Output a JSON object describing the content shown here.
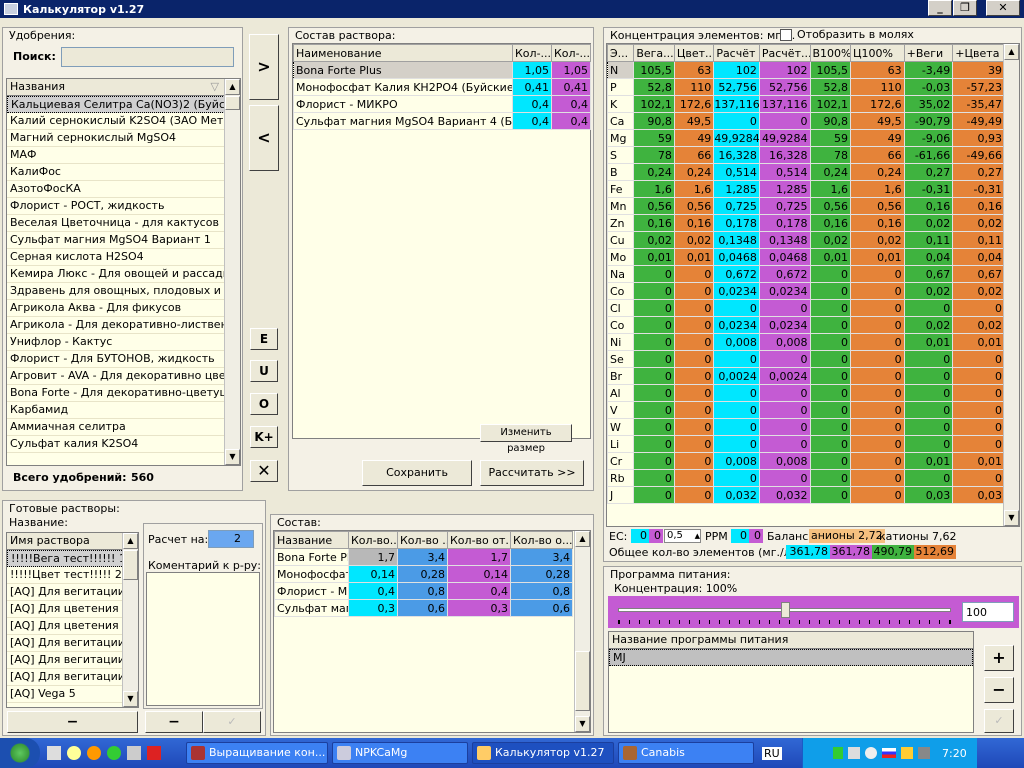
{
  "window": {
    "title": "Калькулятор v1.27",
    "btn_min": "_",
    "btn_max": "❐",
    "btn_close": "✕"
  },
  "fert": {
    "title": "Удобрения:",
    "search_label": "Поиск:",
    "search_value": "",
    "col_header": "Названия",
    "total_label": "Всего удобрений:",
    "total_value": "560",
    "items": [
      "Кальциевая Селитра Ca(NO3)2 (Буйские у",
      "Калий  сернокислый  K2SO4 (ЗАО Метахи",
      "Магний сернокислый MgSO4",
      "МАФ",
      "КалиФос",
      "АзотоФосКА",
      "Флорист - РОСТ, жидкость",
      "Веселая Цветочница - для кактусов",
      "Сульфат магния MgSO4 Вариант 1",
      "Серная кислота H2SO4",
      "Кемира Люкс - Для овощей и рассады",
      "Здравень для овощных, плодовых и садо",
      "Агрикола Аква - Для фикусов",
      "Агрикола - Для декоративно-лиственных",
      "Унифлор - Кактус",
      "Флорист - Для БУТОНОВ, жидкость",
      "Агровит - AVA - Для декоративно цветущ",
      "Bona Forte - Для декоративно-цветущих, ж",
      "Карбамид",
      "Аммиачная селитра",
      "Сульфат калия K2SO4"
    ]
  },
  "mid_buttons": {
    "add": ">",
    "remove": "<",
    "e": "E",
    "u": "U",
    "o": "O",
    "kplus": "K+",
    "close": "✕"
  },
  "solution": {
    "title": "Состав раствора:",
    "col_name": "Наименование",
    "col_q1": "Кол-...",
    "col_q2": "Кол-...",
    "rows": [
      {
        "name": "Bona Forte Plus",
        "q1": "1,05",
        "q2": "1,05"
      },
      {
        "name": "Монофосфат Калия KH2PO4 (Буйские уд-я",
        "q1": "0,41",
        "q2": "0,41"
      },
      {
        "name": "Флорист - МИКРО",
        "q1": "0,4",
        "q2": "0,4"
      },
      {
        "name": "Сульфат магния MgSO4 Вариант 4 (Буйск",
        "q1": "0,4",
        "q2": "0,4"
      }
    ],
    "resize_btn": "Изменить размер",
    "save_btn": "Сохранить",
    "calc_btn": "Рассчитать >>"
  },
  "conc": {
    "title": "Концентрация элементов: мг/л.",
    "moles_label": "Отобразить в молях",
    "cols": [
      "Э...",
      "Вега...",
      "Цвет...",
      "Расчёт",
      "Расчёт...",
      "В100%",
      "Ц100%",
      "+Веги",
      "+Цвета"
    ],
    "rows": [
      [
        "N",
        "105,5",
        "63",
        "102",
        "102",
        "105,5",
        "63",
        "-3,49",
        "39"
      ],
      [
        "P",
        "52,8",
        "110",
        "52,756",
        "52,756",
        "52,8",
        "110",
        "-0,03",
        "-57,23"
      ],
      [
        "K",
        "102,1",
        "172,6",
        "137,116",
        "137,116",
        "102,1",
        "172,6",
        "35,02",
        "-35,47"
      ],
      [
        "Ca",
        "90,8",
        "49,5",
        "0",
        "0",
        "90,8",
        "49,5",
        "-90,79",
        "-49,49"
      ],
      [
        "Mg",
        "59",
        "49",
        "49,9284",
        "49,9284",
        "59",
        "49",
        "-9,06",
        "0,93"
      ],
      [
        "S",
        "78",
        "66",
        "16,328",
        "16,328",
        "78",
        "66",
        "-61,66",
        "-49,66"
      ],
      [
        "B",
        "0,24",
        "0,24",
        "0,514",
        "0,514",
        "0,24",
        "0,24",
        "0,27",
        "0,27"
      ],
      [
        "Fe",
        "1,6",
        "1,6",
        "1,285",
        "1,285",
        "1,6",
        "1,6",
        "-0,31",
        "-0,31"
      ],
      [
        "Mn",
        "0,56",
        "0,56",
        "0,725",
        "0,725",
        "0,56",
        "0,56",
        "0,16",
        "0,16"
      ],
      [
        "Zn",
        "0,16",
        "0,16",
        "0,178",
        "0,178",
        "0,16",
        "0,16",
        "0,02",
        "0,02"
      ],
      [
        "Cu",
        "0,02",
        "0,02",
        "0,1348",
        "0,1348",
        "0,02",
        "0,02",
        "0,11",
        "0,11"
      ],
      [
        "Mo",
        "0,01",
        "0,01",
        "0,0468",
        "0,0468",
        "0,01",
        "0,01",
        "0,04",
        "0,04"
      ],
      [
        "Na",
        "0",
        "0",
        "0,672",
        "0,672",
        "0",
        "0",
        "0,67",
        "0,67"
      ],
      [
        "Co",
        "0",
        "0",
        "0,0234",
        "0,0234",
        "0",
        "0",
        "0,02",
        "0,02"
      ],
      [
        "Cl",
        "0",
        "0",
        "0",
        "0",
        "0",
        "0",
        "0",
        "0"
      ],
      [
        "Co",
        "0",
        "0",
        "0,0234",
        "0,0234",
        "0",
        "0",
        "0,02",
        "0,02"
      ],
      [
        "Ni",
        "0",
        "0",
        "0,008",
        "0,008",
        "0",
        "0",
        "0,01",
        "0,01"
      ],
      [
        "Se",
        "0",
        "0",
        "0",
        "0",
        "0",
        "0",
        "0",
        "0"
      ],
      [
        "Br",
        "0",
        "0",
        "0,0024",
        "0,0024",
        "0",
        "0",
        "0",
        "0"
      ],
      [
        "Al",
        "0",
        "0",
        "0",
        "0",
        "0",
        "0",
        "0",
        "0"
      ],
      [
        "V",
        "0",
        "0",
        "0",
        "0",
        "0",
        "0",
        "0",
        "0"
      ],
      [
        "W",
        "0",
        "0",
        "0",
        "0",
        "0",
        "0",
        "0",
        "0"
      ],
      [
        "Li",
        "0",
        "0",
        "0",
        "0",
        "0",
        "0",
        "0",
        "0"
      ],
      [
        "Cr",
        "0",
        "0",
        "0,008",
        "0,008",
        "0",
        "0",
        "0,01",
        "0,01"
      ],
      [
        "Rb",
        "0",
        "0",
        "0",
        "0",
        "0",
        "0",
        "0",
        "0"
      ],
      [
        "J",
        "0",
        "0",
        "0,032",
        "0,032",
        "0",
        "0",
        "0,03",
        "0,03"
      ]
    ],
    "ec_label": "EC:",
    "ec1": "0",
    "ec2": "0",
    "ec3": "0,5",
    "ppm_label": "PPM",
    "ppm1": "0",
    "ppm2": "0",
    "balance_label": "Баланс:",
    "anions": "анионы 2,72",
    "cations": "катионы 7,62",
    "total_label": "Общее кол-во элементов (мг./л.):",
    "totals": [
      "361,78",
      "361,78",
      "490,79",
      "512,69"
    ]
  },
  "ready": {
    "title": "Готовые растворы:",
    "name_label": "Название:",
    "col": "Имя раствора",
    "items": [
      "!!!!!Вега тест!!!!!! 1",
      "!!!!!Цвет тест!!!!! 2",
      "[AQ] Для вегитации 1",
      "[AQ] Для цветения 1 '",
      "[AQ] Для цветения 2 '",
      "[AQ] Для вегитации 2",
      "[AQ] Для вегитации 4",
      "[AQ] Для вегитации 5",
      "[AQ] Vega 5"
    ],
    "minus": "−",
    "calc_on_label": "Расчет на:",
    "calc_on_value": "2",
    "comment_label": "Коментарий к р-ру:"
  },
  "composition": {
    "title": "Состав:",
    "cols": [
      "Название",
      "Кол-во...",
      "Кол-во ...",
      "Кол-во от...",
      "Кол-во о..."
    ],
    "rows": [
      [
        "Bona Forte Plus",
        "1,7",
        "3,4",
        "1,7",
        "3,4"
      ],
      [
        "Монофосфат K",
        "0,14",
        "0,28",
        "0,14",
        "0,28"
      ],
      [
        "Флорист - МИ",
        "0,4",
        "0,8",
        "0,4",
        "0,8"
      ],
      [
        "Сульфат магн",
        "0,3",
        "0,6",
        "0,3",
        "0,6"
      ]
    ]
  },
  "program": {
    "title": "Программа питания:",
    "conc_label": "Концентрация: 100%",
    "conc_value": "100",
    "slider_level": 0.5,
    "col": "Название программы питания",
    "items": [
      "MJ"
    ],
    "plus": "+",
    "minus": "−",
    "check": "✓"
  },
  "taskbar": {
    "tasks": [
      "Выращивание кон...",
      "NPKCaMg",
      "Калькулятор v1.27",
      "Canabis"
    ],
    "lang": "RU",
    "clock": "7:20"
  },
  "colors": {
    "cyan": "#00e7ff",
    "magenta": "#c45bd3",
    "green": "#3fb33f",
    "orange": "#e58338",
    "title_blue": "#0a246a"
  }
}
